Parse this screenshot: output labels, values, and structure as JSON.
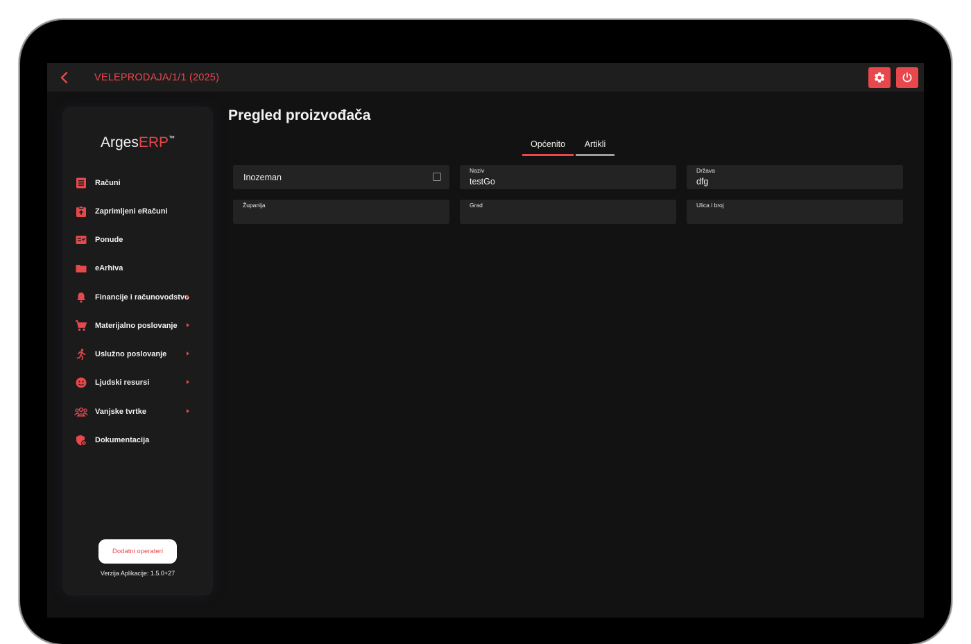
{
  "header": {
    "title": "VELEPRODAJA/1/1 (2025)"
  },
  "brand": {
    "name_prefix": "Arges",
    "name_accent": "ERP",
    "trademark": "™"
  },
  "sidebar": {
    "items": [
      {
        "label": "Računi",
        "icon": "receipt-icon",
        "has_submenu": false
      },
      {
        "label": "Zaprimljeni eRačuni",
        "icon": "inbox-clipboard-icon",
        "has_submenu": false
      },
      {
        "label": "Ponude",
        "icon": "checklist-icon",
        "has_submenu": false
      },
      {
        "label": "eArhiva",
        "icon": "folder-icon",
        "has_submenu": false
      },
      {
        "label": "Financije i računovodstvo",
        "icon": "bell-icon",
        "has_submenu": true
      },
      {
        "label": "Materijalno poslovanje",
        "icon": "cart-icon",
        "has_submenu": true
      },
      {
        "label": "Uslužno poslovanje",
        "icon": "running-person-icon",
        "has_submenu": true
      },
      {
        "label": "Ljudski resursi",
        "icon": "face-icon",
        "has_submenu": true
      },
      {
        "label": "Vanjske tvrtke",
        "icon": "group-icon",
        "has_submenu": true
      },
      {
        "label": "Dokumentacija",
        "icon": "shield-icon",
        "has_submenu": false
      }
    ],
    "extra_operators_button": "Dodatni operateri",
    "version": "Verzija Aplikacije: 1.5.0+27"
  },
  "main": {
    "title": "Pregled proizvođača",
    "tabs": [
      {
        "label": "Općenito",
        "active": true
      },
      {
        "label": "Artikli",
        "active": false
      }
    ],
    "fields": {
      "foreign": {
        "label": "Inozeman",
        "checked": false
      },
      "name": {
        "label": "Naziv",
        "value": "testGo"
      },
      "country": {
        "label": "Država",
        "value": "dfg"
      },
      "county": {
        "label": "Županija",
        "value": ""
      },
      "city": {
        "label": "Grad",
        "value": ""
      },
      "street": {
        "label": "Ulica i broj",
        "value": ""
      }
    }
  },
  "colors": {
    "accent": "#e8474b",
    "background": "#121212",
    "panel": "#1b1b1b",
    "field": "#232323",
    "inactive_tab_bar": "#9e9e9e"
  }
}
